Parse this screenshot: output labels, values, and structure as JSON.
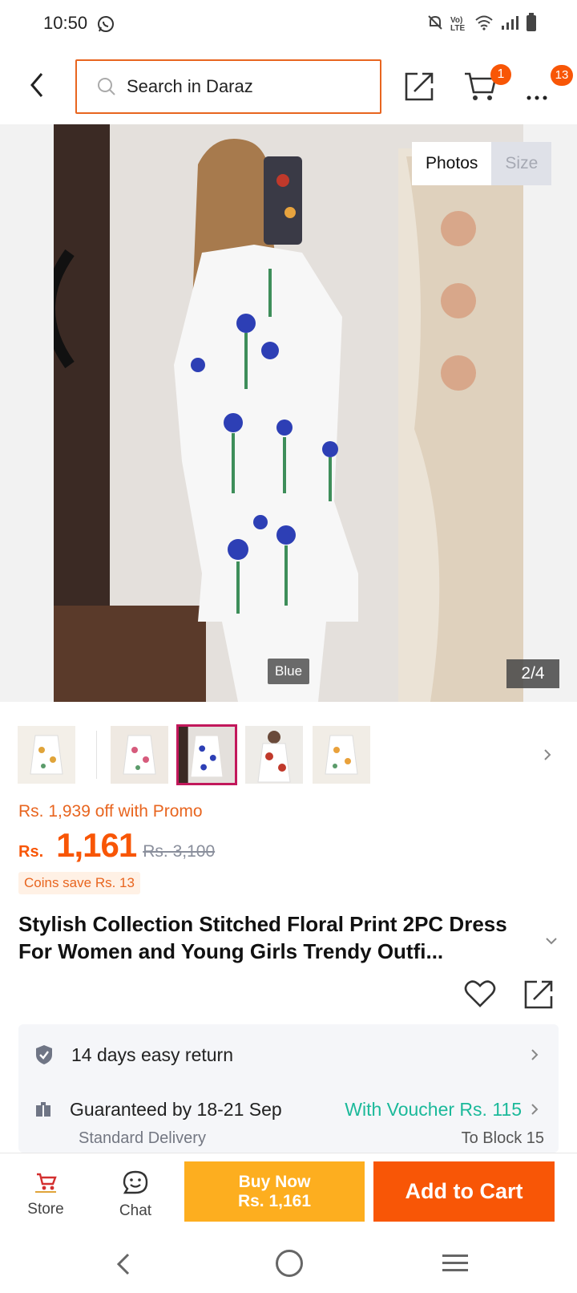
{
  "status_bar": {
    "time": "10:50",
    "network_label": "Vo) LTE"
  },
  "header": {
    "search_placeholder": "Search in Daraz",
    "cart_count": "1",
    "more_count": "13"
  },
  "gallery": {
    "tabs": [
      {
        "label": "Photos"
      },
      {
        "label": "Size"
      }
    ],
    "variant_label": "Blue",
    "page_counter": "2/4"
  },
  "thumbnails": [
    {
      "name": "thumb-1",
      "selected": false
    },
    {
      "name": "thumb-2",
      "selected": false
    },
    {
      "name": "thumb-3",
      "selected": true
    },
    {
      "name": "thumb-4",
      "selected": false
    },
    {
      "name": "thumb-5",
      "selected": false
    }
  ],
  "pricing": {
    "promo_text": "Rs. 1,939 off with Promo",
    "currency": "Rs.",
    "price": "1,161",
    "original_price": "Rs. 3,100",
    "coins_text": "Coins save Rs. 13"
  },
  "product": {
    "title": "Stylish Collection Stitched Floral Print 2PC Dress For Women and Young Girls Trendy Outfi..."
  },
  "services": {
    "return_policy": "14 days easy return",
    "delivery_guarantee": "Guaranteed by 18-21 Sep",
    "voucher": "With Voucher Rs. 115",
    "delivery_type": "Standard Delivery",
    "delivery_location": "To Block 15"
  },
  "bottom_bar": {
    "store_label": "Store",
    "chat_label": "Chat",
    "buy_now_label": "Buy Now",
    "buy_now_price": "Rs. 1,161",
    "add_to_cart_label": "Add to Cart"
  },
  "colors": {
    "accent": "#f85606",
    "buy_now": "#fdae1f",
    "voucher_text": "#1bb99a",
    "search_border": "#e8651f"
  }
}
